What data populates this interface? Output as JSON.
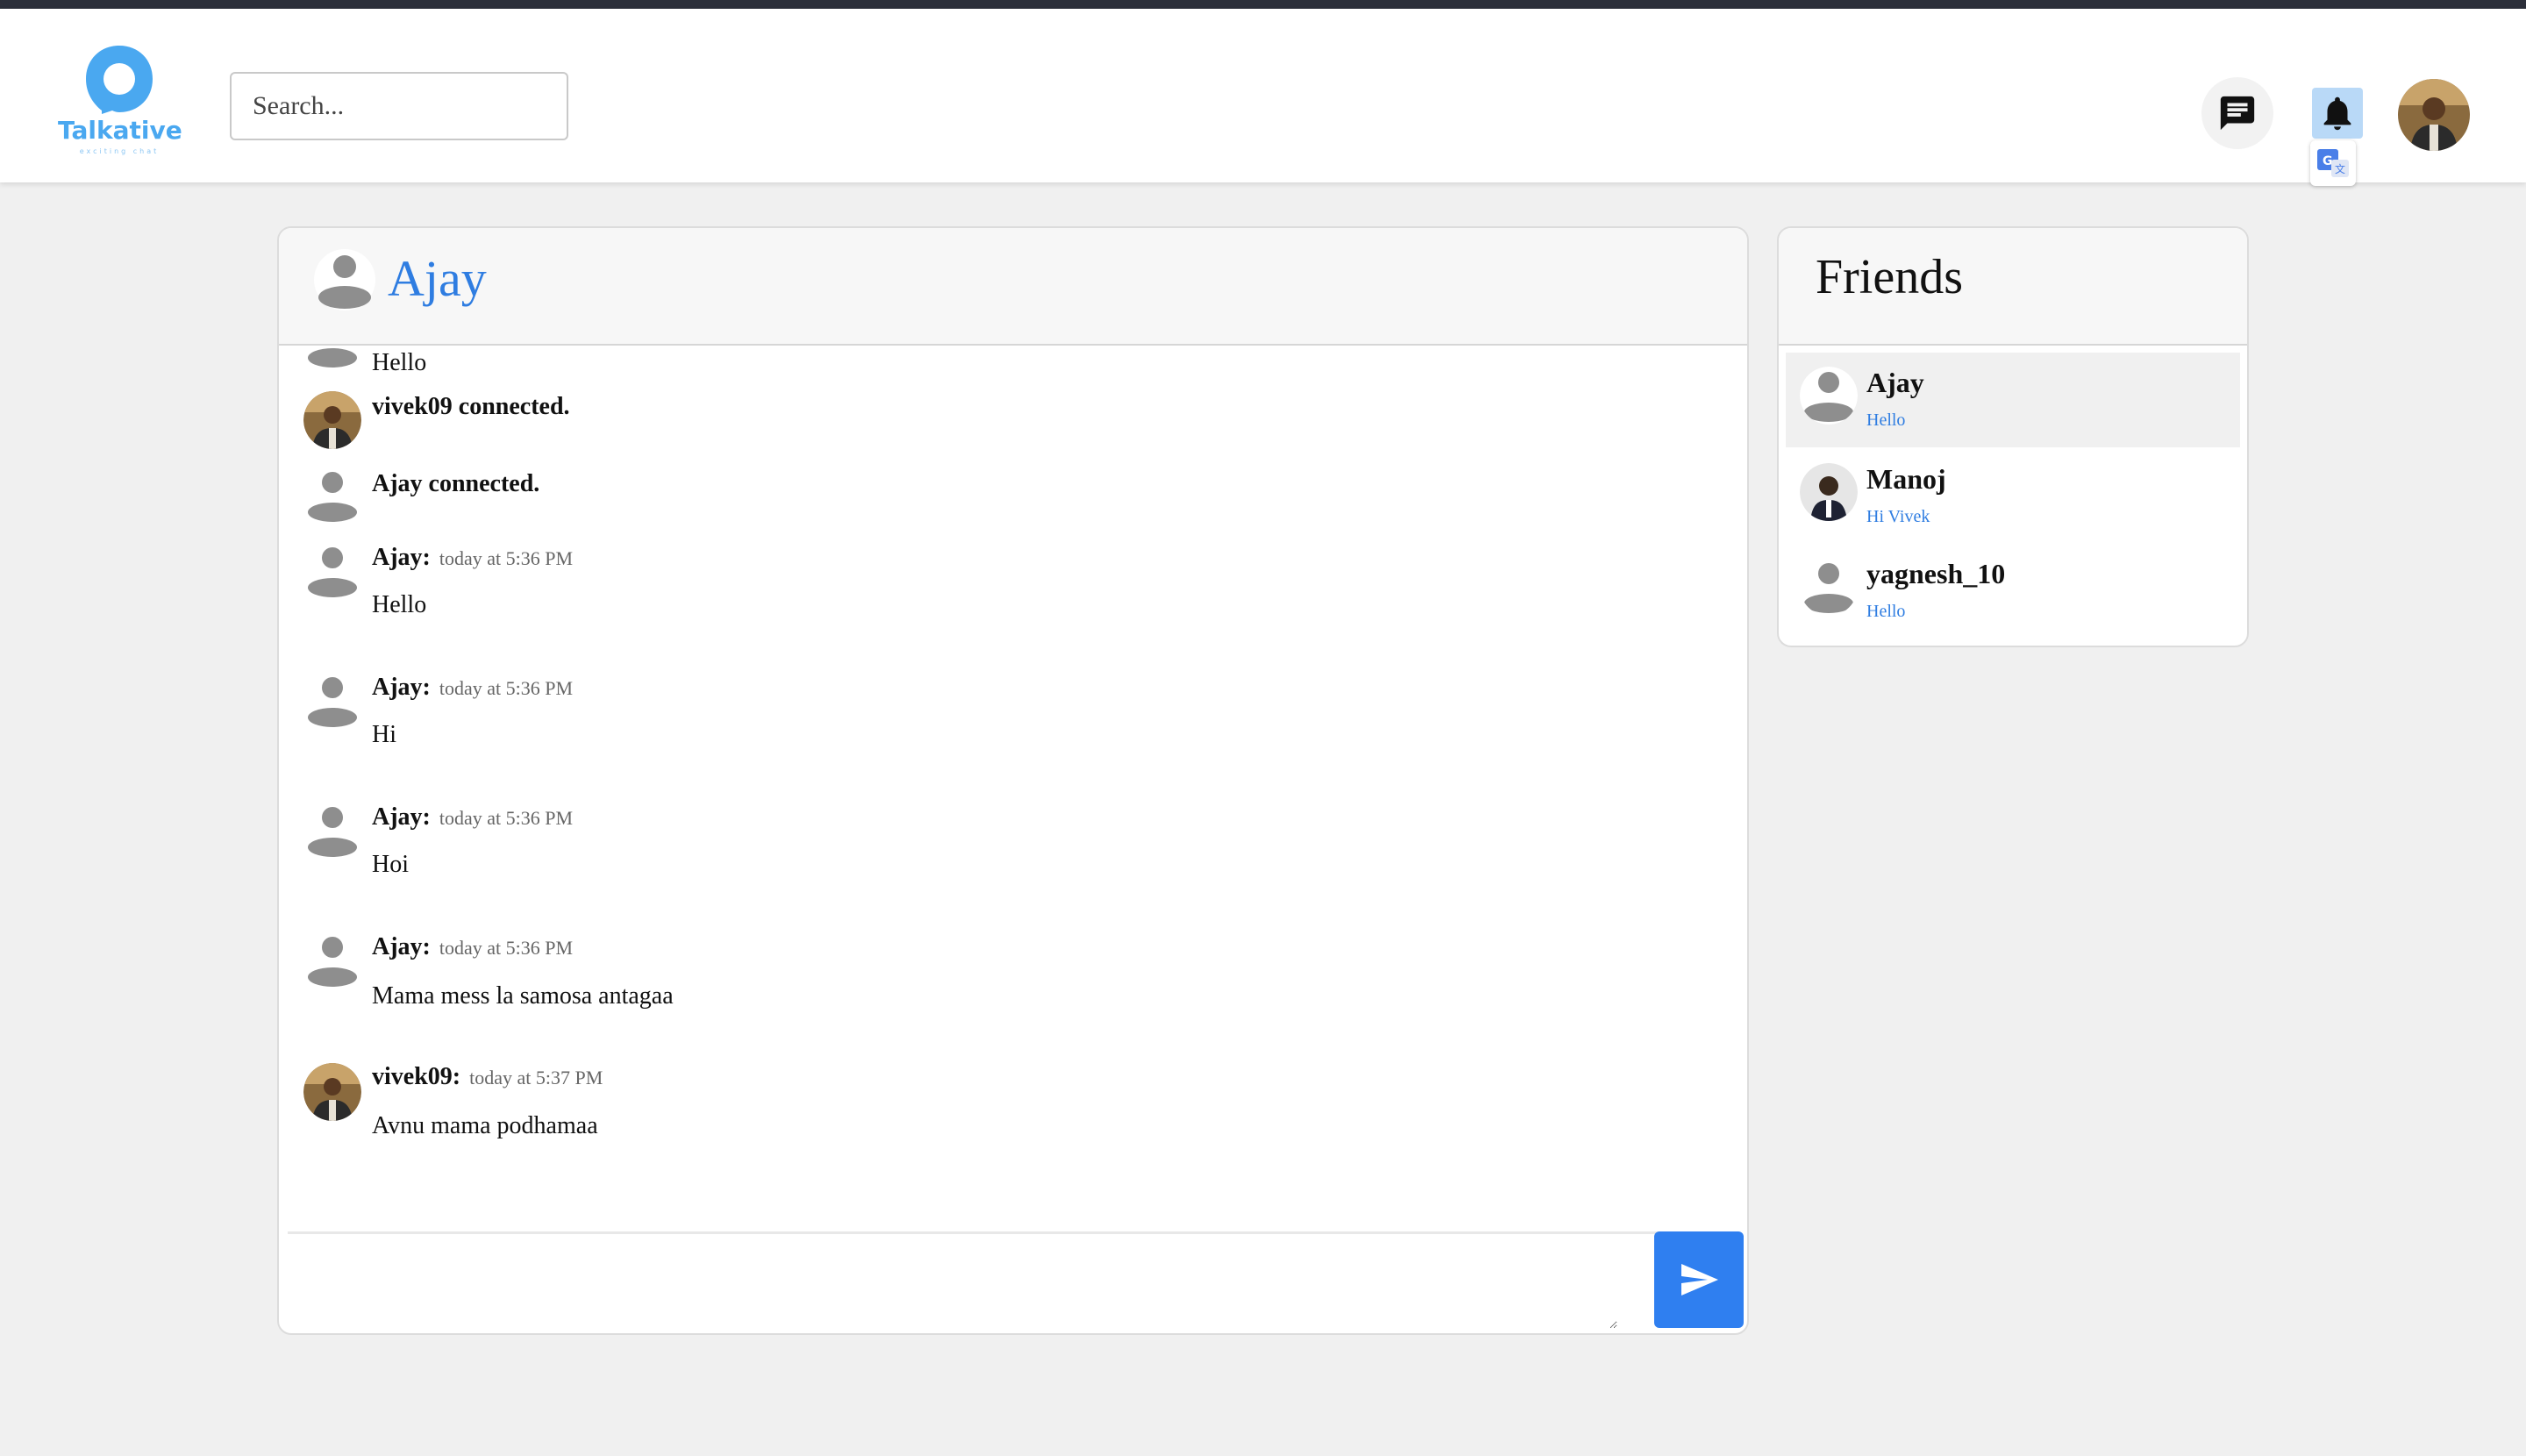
{
  "app": {
    "name": "Talkative",
    "tagline": "exciting chat",
    "accent": "#2f7de1",
    "logo_color": "#4aa8f0"
  },
  "navbar": {
    "search_placeholder": "Search...",
    "icons": [
      "chat-icon",
      "bell-icon",
      "translate-icon"
    ]
  },
  "chat": {
    "title": "Ajay",
    "messages": [
      {
        "type": "message",
        "author": "",
        "time": "",
        "text": "Hello",
        "avatar": "default"
      },
      {
        "type": "system",
        "text": "vivek09 connected.",
        "avatar": "photo"
      },
      {
        "type": "system",
        "text": "Ajay connected.",
        "avatar": "default"
      },
      {
        "type": "message",
        "author": "Ajay:",
        "time": "today at 5:36 PM",
        "text": "Hello",
        "avatar": "default"
      },
      {
        "type": "message",
        "author": "Ajay:",
        "time": "today at 5:36 PM",
        "text": "Hi",
        "avatar": "default"
      },
      {
        "type": "message",
        "author": "Ajay:",
        "time": "today at 5:36 PM",
        "text": "Hoi",
        "avatar": "default"
      },
      {
        "type": "message",
        "author": "Ajay:",
        "time": "today at 5:36 PM",
        "text": "Mama mess la samosa antagaa",
        "avatar": "default"
      },
      {
        "type": "message",
        "author": "vivek09:",
        "time": "today at 5:37 PM",
        "text": "Avnu mama podhamaa",
        "avatar": "photo"
      }
    ],
    "compose_value": "",
    "send_color": "#2f7ff0"
  },
  "friends": {
    "title": "Friends",
    "items": [
      {
        "name": "Ajay",
        "last": "Hello",
        "avatar": "default",
        "active": true
      },
      {
        "name": "Manoj",
        "last": "Hi Vivek",
        "avatar": "photo",
        "active": false
      },
      {
        "name": "yagnesh_10",
        "last": "Hello",
        "avatar": "default",
        "active": false
      }
    ]
  }
}
